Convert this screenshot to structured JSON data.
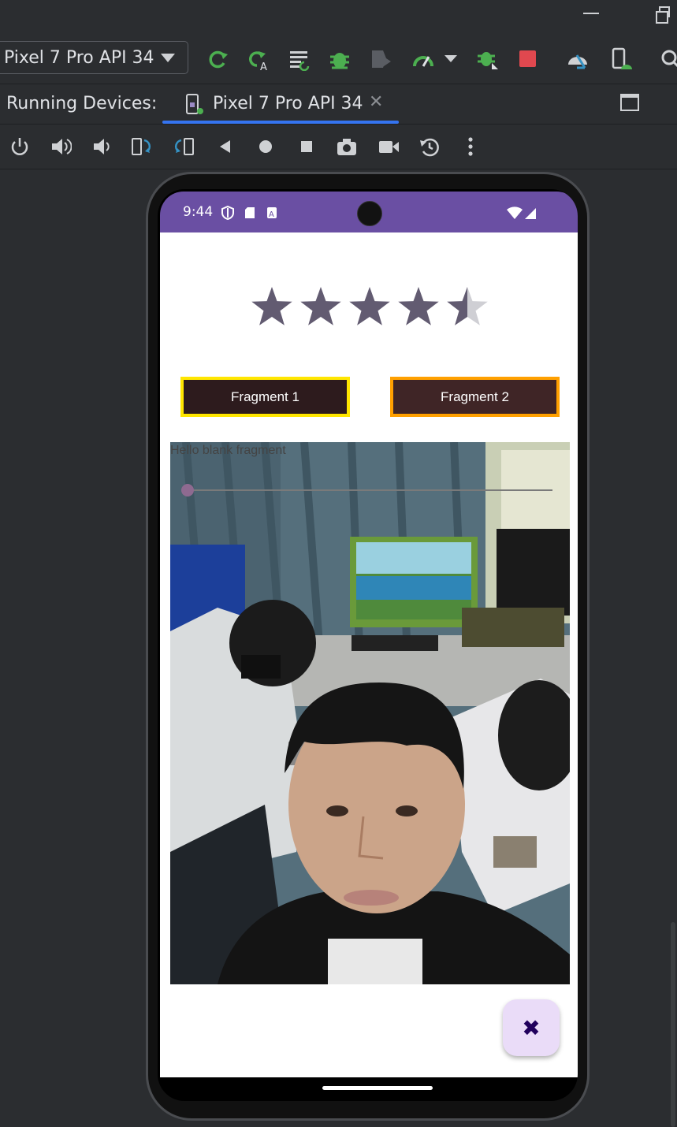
{
  "toolbar": {
    "device_select": "Pixel 7 Pro API 34",
    "icons": [
      "rerun-icon",
      "apply-changes-icon",
      "sync-icon",
      "debug-icon",
      "attach-debugger-icon",
      "profile-icon",
      "more-dropdown-icon",
      "debug-app-icon",
      "stop-icon",
      "device-manager-icon",
      "running-device-icon",
      "search-icon"
    ]
  },
  "panel": {
    "title": "Running Devices:",
    "tab_label": "Pixel 7 Pro API 34"
  },
  "emulator_controls": [
    "power-icon",
    "volume-up-icon",
    "volume-down-icon",
    "rotate-left-icon",
    "rotate-right-icon",
    "back-icon",
    "home-icon",
    "overview-icon",
    "screenshot-icon",
    "screen-record-icon",
    "snapshot-icon",
    "more-icon"
  ],
  "phone": {
    "status_time": "9:44",
    "rating": {
      "value": 4.5,
      "max": 5
    },
    "button_fragment1": "Fragment 1",
    "button_fragment2": "Fragment 2",
    "fragment_text": "Hello blank fragment",
    "seekbar_value": 0,
    "fab_icon": "close-icon",
    "fab_glyph": "✖"
  },
  "colors": {
    "statusbar": "#6a4fa3",
    "star_filled": "#625b71",
    "star_empty": "#cfcfd4",
    "button1_border": "#ffe600",
    "button2_border": "#ffa000",
    "accent": "#3574f0"
  }
}
